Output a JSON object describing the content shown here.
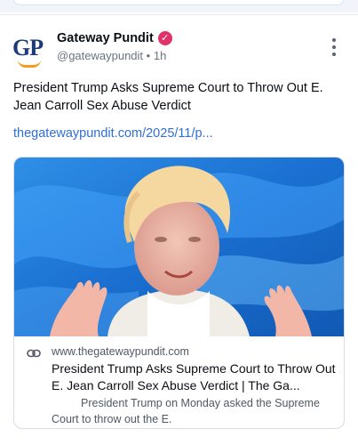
{
  "post": {
    "author": {
      "display_name": "Gateway Pundit",
      "handle": "@gatewaypundit",
      "time": "1h",
      "avatar_text": "GP",
      "verified_icon": "verified-check-icon"
    },
    "text": "President Trump Asks Supreme Court to Throw Out E. Jean Carroll Sex Abuse Verdict",
    "link_text": "thegatewaypundit.com/2025/11/p...",
    "more_icon": "vertical-dots-icon"
  },
  "link_card": {
    "domain": "www.thegatewaypundit.com",
    "title": "President Trump Asks Supreme Court to Throw Out E. Jean Carroll Sex Abuse Verdict | The Ga...",
    "description": "President Trump on Monday asked the Supreme Court to throw out the E.",
    "link_icon": "link-icon"
  },
  "colors": {
    "link": "#2f6fd6",
    "verified": "#e0336b",
    "avatar_text": "#1c3b7a",
    "avatar_accent": "#f29c1f",
    "background_blue": "#1a78d6"
  }
}
